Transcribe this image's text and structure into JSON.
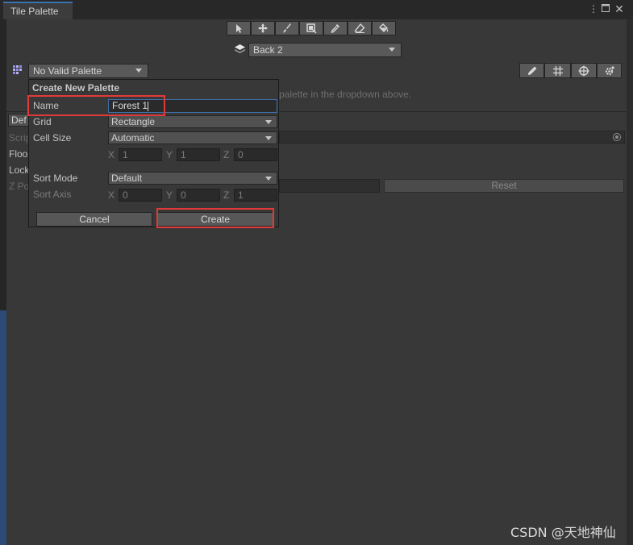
{
  "window": {
    "tab_title": "Tile Palette",
    "icons": {
      "menu": "kebab-menu-icon",
      "maximize": "maximize-icon",
      "close": "close-icon"
    }
  },
  "toolbar": {
    "tools": [
      {
        "name": "select-tool-icon"
      },
      {
        "name": "move-tool-icon"
      },
      {
        "name": "paint-brush-icon"
      },
      {
        "name": "box-fill-icon"
      },
      {
        "name": "picker-icon"
      },
      {
        "name": "eraser-icon"
      },
      {
        "name": "fill-bucket-icon"
      }
    ],
    "layer_dropdown": "Back 2",
    "palette_dropdown": "No Valid Palette",
    "right_tools": [
      "edit-pencil-icon",
      "grid-icon",
      "gizmo-icon",
      "settings-icon"
    ]
  },
  "background": {
    "hint_text": "palette in the dropdown above.",
    "reset_label": "Reset",
    "partial_labels": [
      "Def",
      "Scrip",
      "Floo",
      "Lock",
      "Z Po"
    ]
  },
  "popup": {
    "title": "Create New Palette",
    "name_label": "Name",
    "name_value": "Forest 1",
    "grid_label": "Grid",
    "grid_value": "Rectangle",
    "cell_size_label": "Cell Size",
    "cell_size_value": "Automatic",
    "cell": {
      "x_label": "X",
      "x": "1",
      "y_label": "Y",
      "y": "1",
      "z_label": "Z",
      "z": "0"
    },
    "sort_mode_label": "Sort Mode",
    "sort_mode_value": "Default",
    "sort_axis_label": "Sort Axis",
    "sort_axis": {
      "x_label": "X",
      "x": "0",
      "y_label": "Y",
      "y": "0",
      "z_label": "Z",
      "z": "1"
    },
    "cancel_label": "Cancel",
    "create_label": "Create"
  },
  "watermark": "CSDN @天地神仙"
}
